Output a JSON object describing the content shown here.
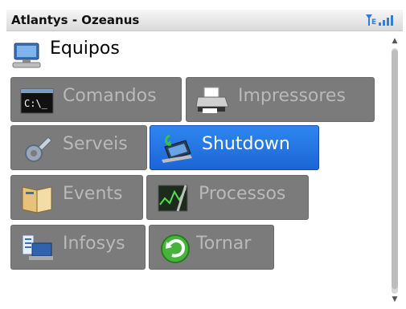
{
  "app": {
    "title": "Atlantys - Ozeanus"
  },
  "status": {
    "signal_icon": "signal-strength-icon"
  },
  "section": {
    "title": "Equipos",
    "icon": "computer-icon"
  },
  "menu": {
    "items": [
      {
        "label": "Comandos",
        "icon": "terminal-icon",
        "selected": false
      },
      {
        "label": "Impressores",
        "icon": "printer-icon",
        "selected": false
      },
      {
        "label": "Serveis",
        "icon": "wrench-gear-icon",
        "selected": false
      },
      {
        "label": "Shutdown",
        "icon": "laptop-shutdown-icon",
        "selected": true
      },
      {
        "label": "Events",
        "icon": "book-icon",
        "selected": false
      },
      {
        "label": "Processos",
        "icon": "process-monitor-icon",
        "selected": false
      },
      {
        "label": "Infosys",
        "icon": "system-info-icon",
        "selected": false
      },
      {
        "label": "Tornar",
        "icon": "return-arrow-icon",
        "selected": false
      }
    ]
  },
  "colors": {
    "button": "#7b7b7b",
    "selected": "#1f70e0",
    "title_bar": "#e6e6e6"
  }
}
